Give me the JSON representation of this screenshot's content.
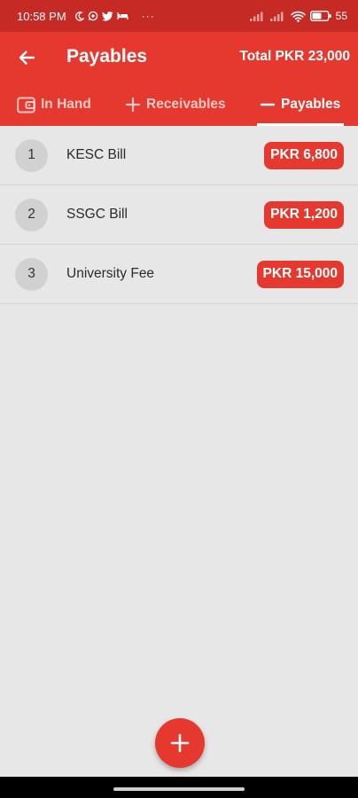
{
  "status_bar": {
    "time": "10:58 PM",
    "icons": [
      "moon-icon",
      "whatsapp-icon",
      "twitter-icon",
      "bed-icon"
    ],
    "more": "···",
    "battery": "55"
  },
  "app_bar": {
    "title": "Payables",
    "total": "Total PKR 23,000"
  },
  "tabs": [
    {
      "label": "In Hand",
      "icon": "wallet-icon",
      "active": false
    },
    {
      "label": "Receivables",
      "icon": "plus-icon",
      "active": false
    },
    {
      "label": "Payables",
      "icon": "minus-icon",
      "active": true
    }
  ],
  "items": [
    {
      "index": "1",
      "name": "KESC Bill",
      "amount": "PKR 6,800"
    },
    {
      "index": "2",
      "name": "SSGC Bill",
      "amount": "PKR 1,200"
    },
    {
      "index": "3",
      "name": "University Fee",
      "amount": "PKR 15,000"
    }
  ],
  "colors": {
    "primary": "#e5392f",
    "status_bar": "#c62a24",
    "background": "#e7e7e7"
  }
}
